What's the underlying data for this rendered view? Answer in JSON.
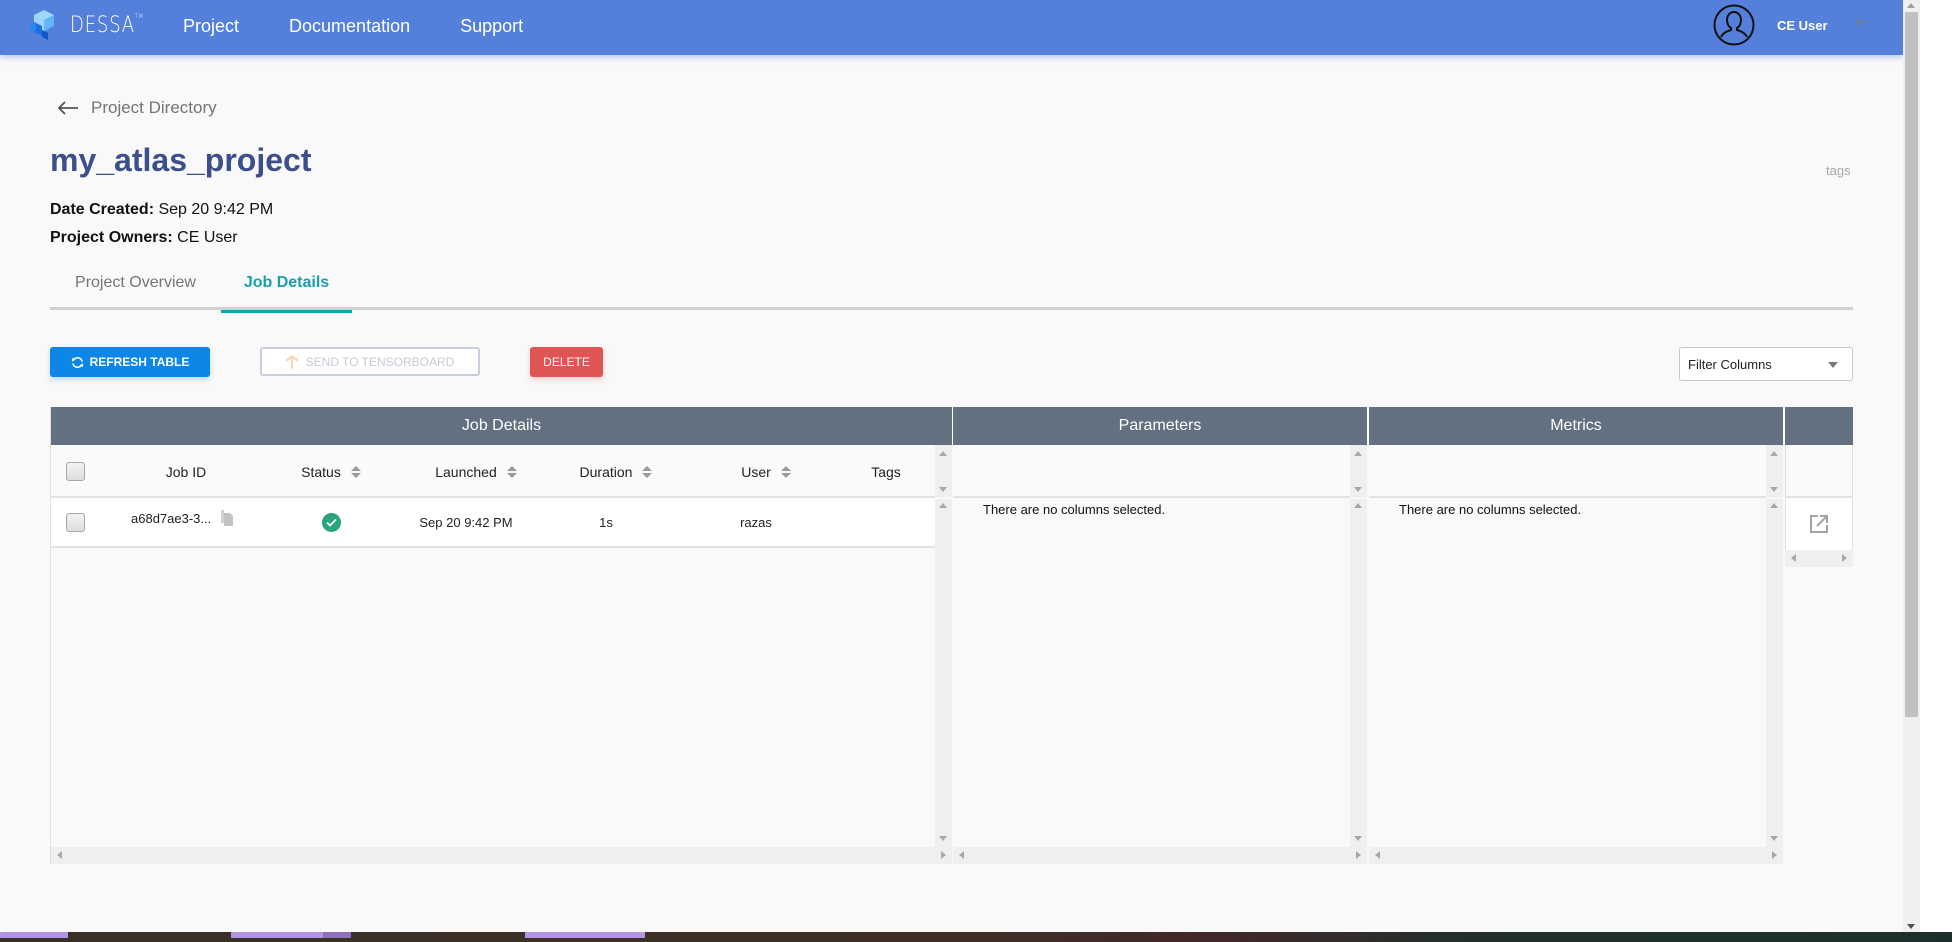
{
  "topbar": {
    "brand": "DESSA",
    "brand_mark": "TM",
    "nav": [
      "Project",
      "Documentation",
      "Support"
    ],
    "user_name": "CE User",
    "color": "#5480dc"
  },
  "breadcrumb": {
    "back_label": "Project Directory"
  },
  "project": {
    "title": "my_atlas_project",
    "date_created_label": "Date Created:",
    "date_created": "Sep 20 9:42 PM",
    "owners_label": "Project Owners:",
    "owners": "CE User",
    "tags_label": "tags"
  },
  "tabs": [
    {
      "label": "Project Overview",
      "active": false
    },
    {
      "label": "Job Details",
      "active": true
    }
  ],
  "toolbar": {
    "refresh_label": "REFRESH TABLE",
    "tensorboard_label": "SEND TO TENSORBOARD",
    "delete_label": "DELETE",
    "filter_placeholder": "Filter Columns"
  },
  "grid": {
    "job_panel": {
      "title": "Job Details",
      "columns": [
        "Job ID",
        "Status",
        "Launched",
        "Duration",
        "User",
        "Tags"
      ],
      "rows": [
        {
          "job_id": "a68d7ae3-3...",
          "status": "completed",
          "launched": "Sep 20 9:42 PM",
          "duration": "1s",
          "user": "razas",
          "tags": ""
        }
      ]
    },
    "parameters_panel": {
      "title": "Parameters",
      "empty_message": "There are no columns selected."
    },
    "metrics_panel": {
      "title": "Metrics",
      "empty_message": "There are no columns selected."
    }
  },
  "colors": {
    "primary_button": "#0d86e8",
    "danger_button": "#df5454",
    "active_tab": "#10a2ae",
    "panel_header": "#627080",
    "title": "#3c4f8a",
    "success": "#2aa47a"
  }
}
